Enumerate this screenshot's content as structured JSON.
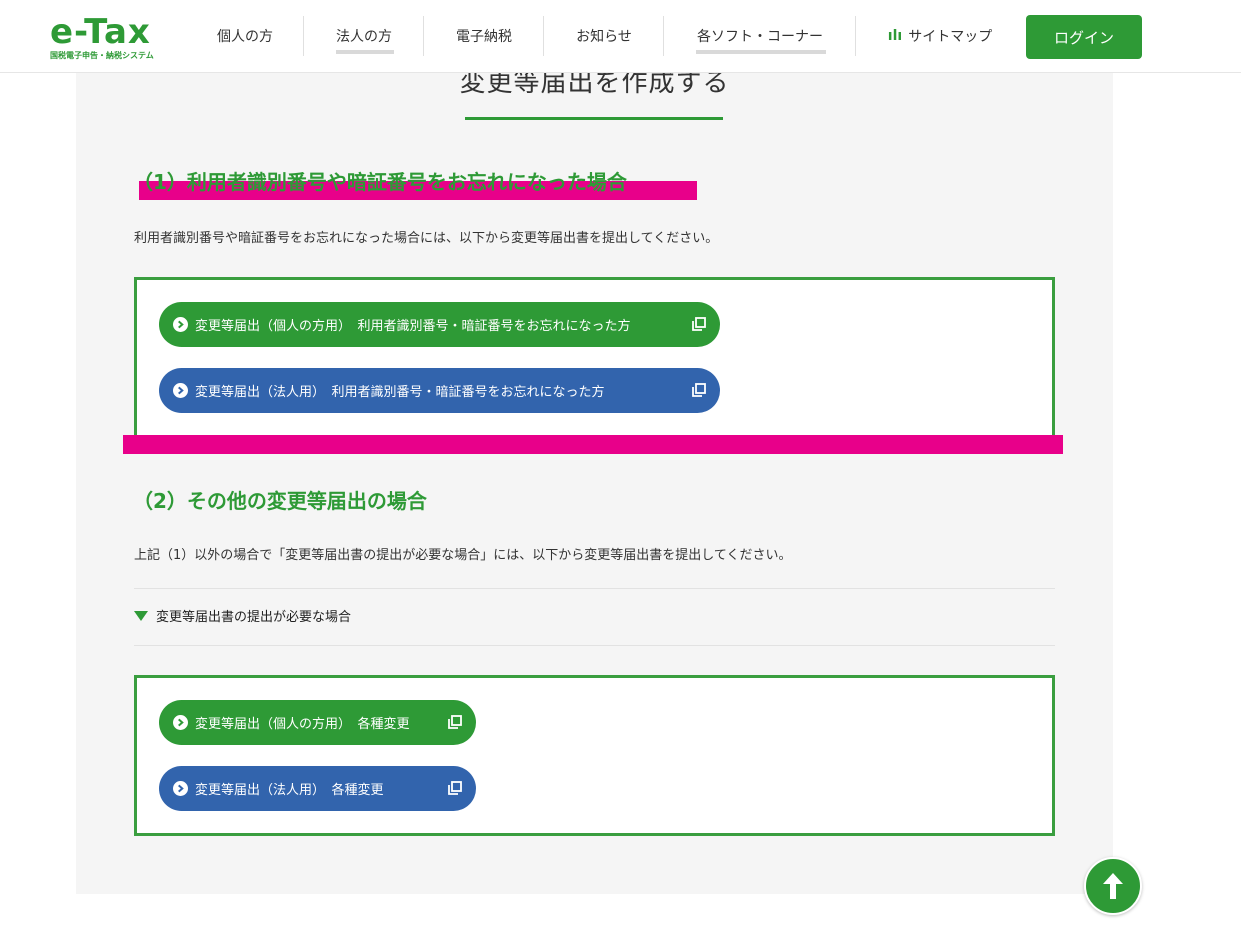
{
  "header": {
    "logo_text": "e-Tax",
    "logo_subtitle": "国税電子申告・納税システム",
    "nav": [
      {
        "label": "個人の方"
      },
      {
        "label": "法人の方"
      },
      {
        "label": "電子納税"
      },
      {
        "label": "お知らせ"
      },
      {
        "label": "各ソフト・コーナー"
      }
    ],
    "sitemap_label": "サイトマップ",
    "login_label": "ログイン"
  },
  "main": {
    "title": "変更等届出を作成する",
    "section1": {
      "heading": "（1）利用者識別番号や暗証番号をお忘れになった場合",
      "text": "利用者識別番号や暗証番号をお忘れになった場合には、以下から変更等届出書を提出してください。",
      "buttons": [
        {
          "label": "変更等届出（個人の方用）　利用者識別番号・暗証番号をお忘れになった方",
          "color": "#2e9a36"
        },
        {
          "label": "変更等届出（法人用）　利用者識別番号・暗証番号をお忘れになった方",
          "color": "#3264ad"
        }
      ]
    },
    "section2": {
      "heading": "（2）その他の変更等届出の場合",
      "text": "上記（1）以外の場合で「変更等届出書の提出が必要な場合」には、以下から変更等届出書を提出してください。",
      "accordion_label": "変更等届出書の提出が必要な場合",
      "buttons": [
        {
          "label": "変更等届出（個人の方用）　各種変更",
          "color": "#2e9a36"
        },
        {
          "label": "変更等届出（法人用）　各種変更",
          "color": "#3264ad"
        }
      ]
    }
  },
  "colors": {
    "accent": "#2e9a36",
    "corporate_blue": "#3264ad",
    "highlight": "#e8008a"
  }
}
